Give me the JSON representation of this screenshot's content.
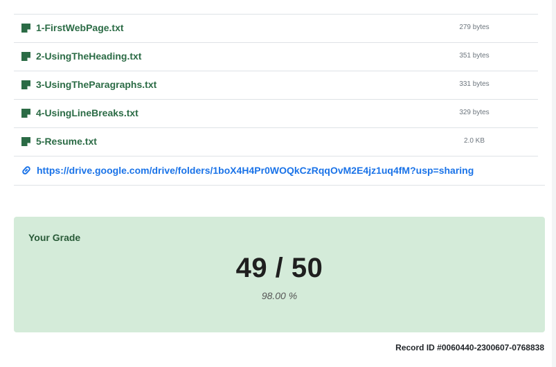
{
  "files": [
    {
      "name": "1-FirstWebPage.txt",
      "size": "279 bytes"
    },
    {
      "name": "2-UsingTheHeading.txt",
      "size": "351 bytes"
    },
    {
      "name": "3-UsingTheParagraphs.txt",
      "size": "331 bytes"
    },
    {
      "name": "4-UsingLineBreaks.txt",
      "size": "329 bytes"
    },
    {
      "name": "5-Resume.txt",
      "size": "2.0 KB"
    }
  ],
  "link": {
    "url": "https://drive.google.com/drive/folders/1boX4H4Pr0WOQkCzRqqOvM2E4jz1uq4fM?usp=sharing",
    "icon": "link-icon"
  },
  "file_icon": "file-text-icon",
  "grade": {
    "heading": "Your Grade",
    "score": "49 / 50",
    "percent": "98.00 %"
  },
  "record_id": "Record ID #0060440-2300607-0768838",
  "colors": {
    "file_link": "#2b6b45",
    "url_link": "#1a73e8",
    "grade_bg": "#d4ebd9"
  }
}
